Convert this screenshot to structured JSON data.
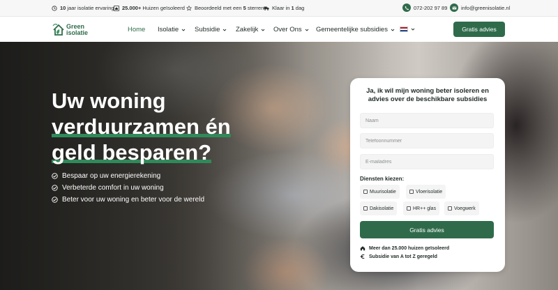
{
  "topbar": {
    "items": [
      {
        "bold": "10",
        "text": " jaar isolatie ervaring",
        "icon": "clock-icon"
      },
      {
        "bold": "25.000+",
        "text": " Huizen geïsoleerd",
        "icon": "home-icon"
      },
      {
        "pre": "Beoordeeld met een ",
        "bold": "5",
        "text": " sterren",
        "icon": "star-icon"
      },
      {
        "pre": "Klaar in ",
        "bold": "1",
        "text": " dag",
        "icon": "truck-icon"
      }
    ],
    "phone": "072-202 97 89",
    "email": "info@greenisolatie.nl"
  },
  "brand": {
    "line1": "Green",
    "line2": "isolatie",
    "color": "#2f6b4b"
  },
  "nav": {
    "items": [
      {
        "label": "Home",
        "active": true
      },
      {
        "label": "Isolatie",
        "dropdown": true
      },
      {
        "label": "Subsidie",
        "dropdown": true
      },
      {
        "label": "Zakelijk",
        "dropdown": true
      },
      {
        "label": "Over Ons",
        "dropdown": true
      },
      {
        "label": "Gemeentelijke subsidies",
        "dropdown": true
      }
    ],
    "language_flag": "nl-flag-icon",
    "cta": "Gratis advies"
  },
  "hero": {
    "headline": {
      "line1": "Uw woning",
      "line2": "verduurzamen én",
      "line3": "geld besparen?"
    },
    "benefits": [
      "Bespaar op uw energierekening",
      "Verbeterde comfort in uw woning",
      "Beter voor uw woning en beter voor de wereld"
    ]
  },
  "form": {
    "title": "Ja, ik wil mijn woning beter isoleren en advies over de beschikbare subsidies",
    "name_placeholder": "Naam",
    "phone_placeholder": "Telefoonnummer",
    "email_placeholder": "E-mailadres",
    "services_label": "Diensten kiezen:",
    "services": [
      "Muurisolatie",
      "Vloerisolatie",
      "Dakisolatie",
      "HR++ glas",
      "Voegwerk"
    ],
    "submit": "Gratis advies",
    "footer": [
      {
        "icon": "home-icon",
        "text": "Meer dan 25.000 huizen geïsoleerd"
      },
      {
        "icon": "euro-icon",
        "text": "Subsidie van A tot Z geregeld"
      }
    ]
  },
  "colors": {
    "accent": "#2f6b4b",
    "highlight": "#2f8a5a"
  }
}
